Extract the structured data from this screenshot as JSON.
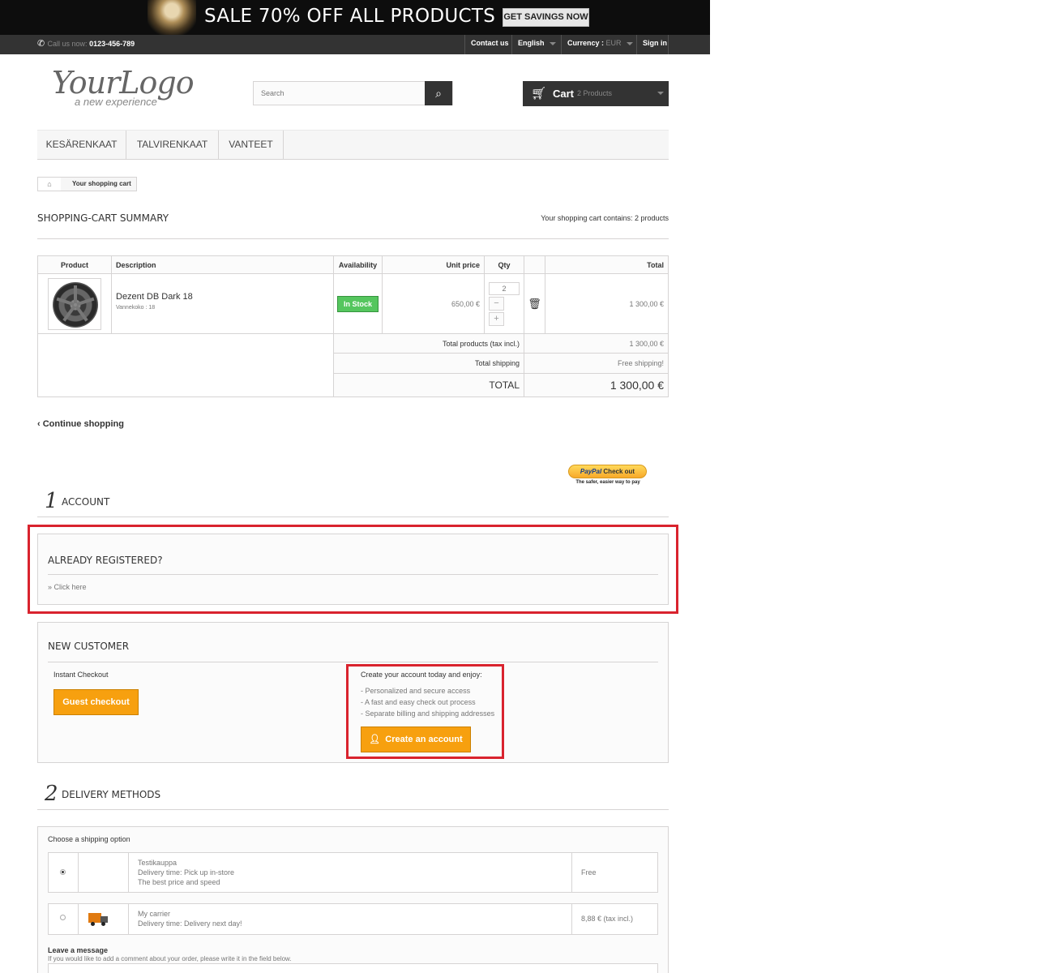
{
  "banner": {
    "headline": "SALE 70% OFF ALL PRODUCTS",
    "cta": "GET SAVINGS NOW"
  },
  "topbar": {
    "call_label": "Call us now:",
    "phone": "0123-456-789",
    "contact": "Contact us",
    "language": "English",
    "currency_label": "Currency :",
    "currency_value": "EUR",
    "signin": "Sign in"
  },
  "header": {
    "logo_main": "YourLogo",
    "logo_sub": "a new experience",
    "search_placeholder": "Search",
    "cart_label": "Cart",
    "cart_count": "2 Products"
  },
  "menu": [
    "KESÄRENKAAT",
    "TALVIRENKAAT",
    "VANTEET"
  ],
  "breadcrumb": {
    "current": "Your shopping cart"
  },
  "summary": {
    "title": "SHOPPING-CART SUMMARY",
    "count_text": "Your shopping cart contains: 2 products",
    "headers": {
      "product": "Product",
      "description": "Description",
      "availability": "Availability",
      "unit_price": "Unit price",
      "qty": "Qty",
      "total": "Total"
    },
    "item": {
      "name": "Dezent DB Dark 18",
      "attr": "Vannekoko : 18",
      "availability": "In Stock",
      "unit_price": "650,00 €",
      "qty": "2",
      "total": "1 300,00 €"
    },
    "totals": {
      "products_label": "Total products (tax incl.)",
      "products_value": "1 300,00 €",
      "shipping_label": "Total shipping",
      "shipping_value": "Free shipping!",
      "grand_label": "TOTAL",
      "grand_value": "1 300,00 €"
    }
  },
  "continue_shopping": "Continue shopping",
  "paypal": {
    "brand": "PayPal",
    "action": "Check out",
    "tagline": "The safer, easier way to pay"
  },
  "account": {
    "step": "1",
    "title": "ACCOUNT",
    "registered_title": "ALREADY REGISTERED?",
    "click_here": "» Click here",
    "new_title": "NEW CUSTOMER",
    "instant_label": "Instant Checkout",
    "guest_button": "Guest checkout",
    "create_heading": "Create your account today and enjoy:",
    "benefits": [
      "- Personalized and secure access",
      "- A fast and easy check out process",
      "- Separate billing and shipping addresses"
    ],
    "create_button": "Create an account"
  },
  "delivery": {
    "step": "2",
    "title": "DELIVERY METHODS",
    "choose_label": "Choose a shipping option",
    "options": [
      {
        "name": "Testikauppa",
        "line1": "Delivery time: Pick up in-store",
        "line2": "The best price and speed",
        "price": "Free"
      },
      {
        "name": "My carrier",
        "line1": "Delivery time: Delivery next day!",
        "price": "8,88 € (tax incl.)"
      }
    ],
    "message_title": "Leave a message",
    "message_hint": "If you would like to add a comment about your order, please write it in the field below."
  },
  "colors": {
    "accent_orange": "#f7a00f",
    "stock_green": "#55c65e",
    "highlight_red": "#d9232e",
    "dark_bar": "#333333"
  }
}
